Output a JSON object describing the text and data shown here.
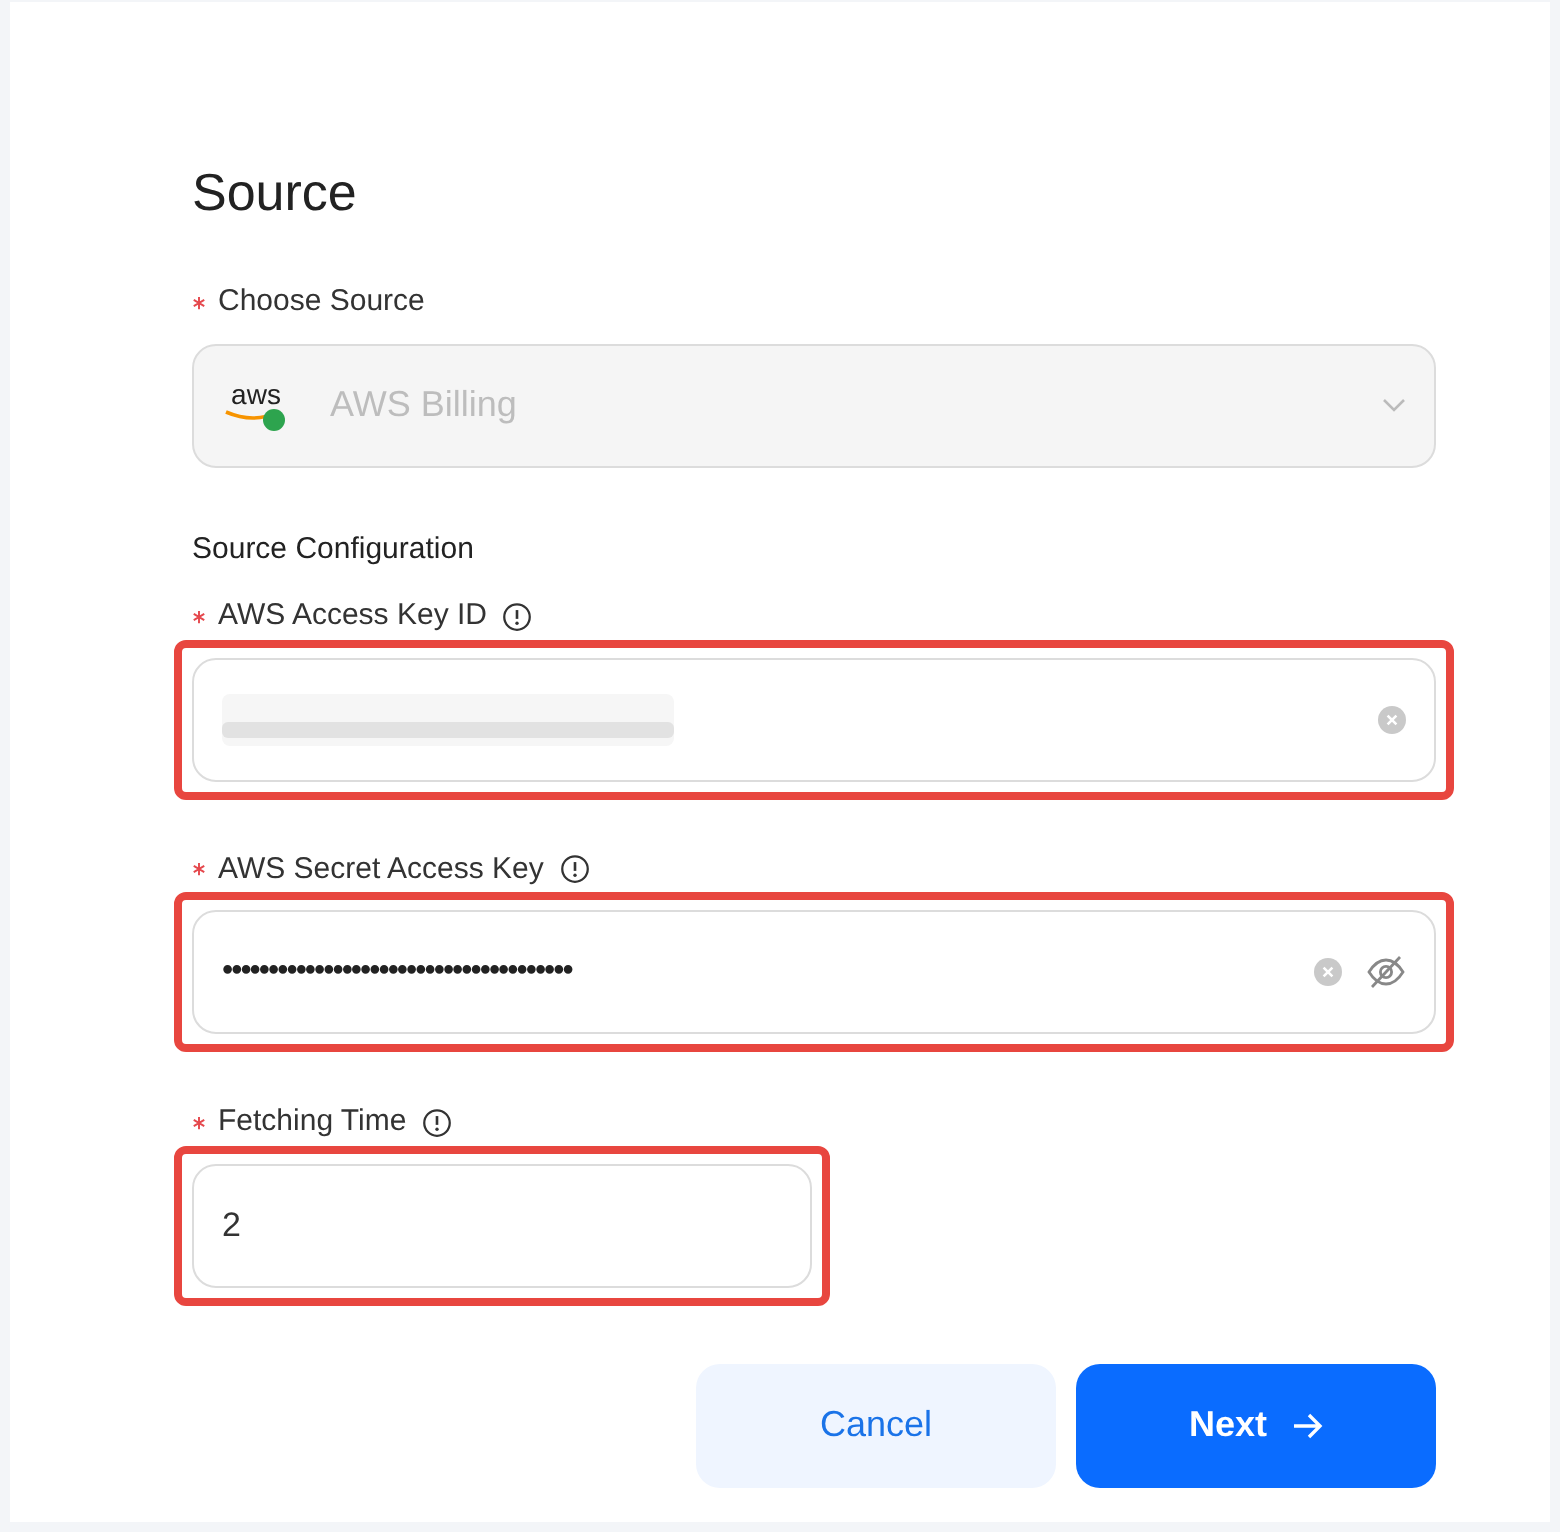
{
  "title": "Source",
  "choose_source": {
    "label": "Choose Source",
    "required": true,
    "logo_text": "aws",
    "value": "AWS Billing",
    "disabled": true
  },
  "section_title": "Source Configuration",
  "fields": [
    {
      "kind": "redacted",
      "label": "AWS Access Key ID",
      "required": true,
      "info": true,
      "highlighted": true,
      "clearable": true
    },
    {
      "kind": "password",
      "label": "AWS Secret Access Key",
      "required": true,
      "info": true,
      "highlighted": true,
      "clearable": true,
      "value": "••••••••••••••••••••••••••••••••••••••"
    },
    {
      "kind": "number",
      "label": "Fetching Time",
      "required": true,
      "info": true,
      "highlighted": true,
      "clearable": false,
      "value": "2"
    }
  ],
  "buttons": [
    {
      "kind": "secondary",
      "label": "Cancel"
    },
    {
      "kind": "primary",
      "label": "Next"
    }
  ]
}
